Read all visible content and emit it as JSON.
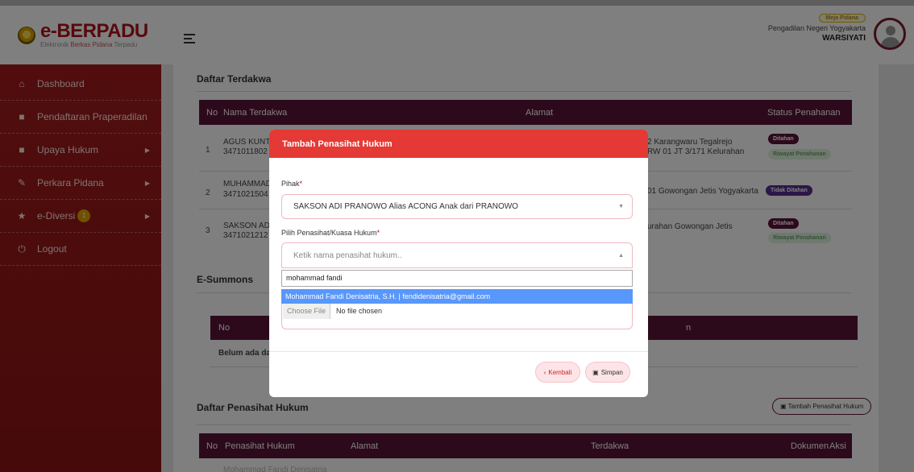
{
  "app": {
    "name": "e-BERPADU",
    "tagline_pre": "Elektronik ",
    "tagline_mid": "Berkas Pidana",
    "tagline_post": " Terpadu"
  },
  "header": {
    "role_badge": "Meja Pidana",
    "court": "Pengadilan Negeri Yogyakarta",
    "user": "WARSIYATI"
  },
  "sidebar": {
    "items": [
      {
        "label": "Dashboard",
        "icon": "home-icon"
      },
      {
        "label": "Pendaftaran Praperadilan",
        "icon": "file-icon"
      },
      {
        "label": "Upaya Hukum",
        "icon": "file-icon"
      },
      {
        "label": "Perkara Pidana",
        "icon": "edit-icon"
      },
      {
        "label": "e-Diversi",
        "icon": "star-icon",
        "badge": "1"
      },
      {
        "label": "Logout",
        "icon": "power-icon"
      }
    ]
  },
  "terdakwa": {
    "title": "Daftar Terdakwa",
    "headers": {
      "no": "No",
      "nama": "Nama Terdakwa",
      "alamat": "Alamat",
      "status": "Status Penahanan"
    },
    "rows": [
      {
        "no": "1",
        "nama": "AGUS KUNT",
        "nik": "3471011802",
        "alamat1": "2 Karangwaru Tegalrejo",
        "alamat2": "RW 01 JT 3/171 Kelurahan",
        "status": "Ditahan",
        "status2": "Riwayat Penahanan"
      },
      {
        "no": "2",
        "nama": "MUHAMMAD",
        "nik": "3471021504",
        "alamat1": "01 Gowongan Jetis Yogyakarta",
        "alamat2": "",
        "status": "Tidak Ditahan",
        "status2": ""
      },
      {
        "no": "3",
        "nama": "SAKSON ADI",
        "nik": "3471021212",
        "alamat1": "urahan Gowongan Jetis",
        "alamat2": "",
        "status": "Ditahan",
        "status2": "Riwayat Penahanan"
      }
    ]
  },
  "esummons": {
    "title": "E-Summons",
    "header_no": "No",
    "header_right": "n",
    "empty": "Belum ada da"
  },
  "penasihat": {
    "title": "Daftar Penasihat Hukum",
    "add_button": "Tambah Penasihat Hukum",
    "headers": {
      "no": "No",
      "nama": "Penasihat Hukum",
      "alamat": "Alamat",
      "terdakwa": "Terdakwa",
      "dokumen": "Dokumen",
      "aksi": "Aksi"
    },
    "partial_row": "Mohammad Fandi Denisatria"
  },
  "modal": {
    "title": "Tambah Penasihat Hukum",
    "pihak_label": "Pihak",
    "pihak_value": "SAKSON ADI PRANOWO Alias ACONG Anak dari PRANOWO",
    "ph_label": "Pilih Penasihat/Kuasa Hukum",
    "ph_placeholder": "Ketik nama penasihat hukum..",
    "search_value": "mohammad fandi",
    "option": "Mohammad Fandi Denisatria, S.H. | fendidenisatria@gmail.com",
    "file_button": "Choose File",
    "file_status": "No file chosen",
    "back_button": "Kembali",
    "save_button": "Simpan",
    "required_mark": "*"
  }
}
